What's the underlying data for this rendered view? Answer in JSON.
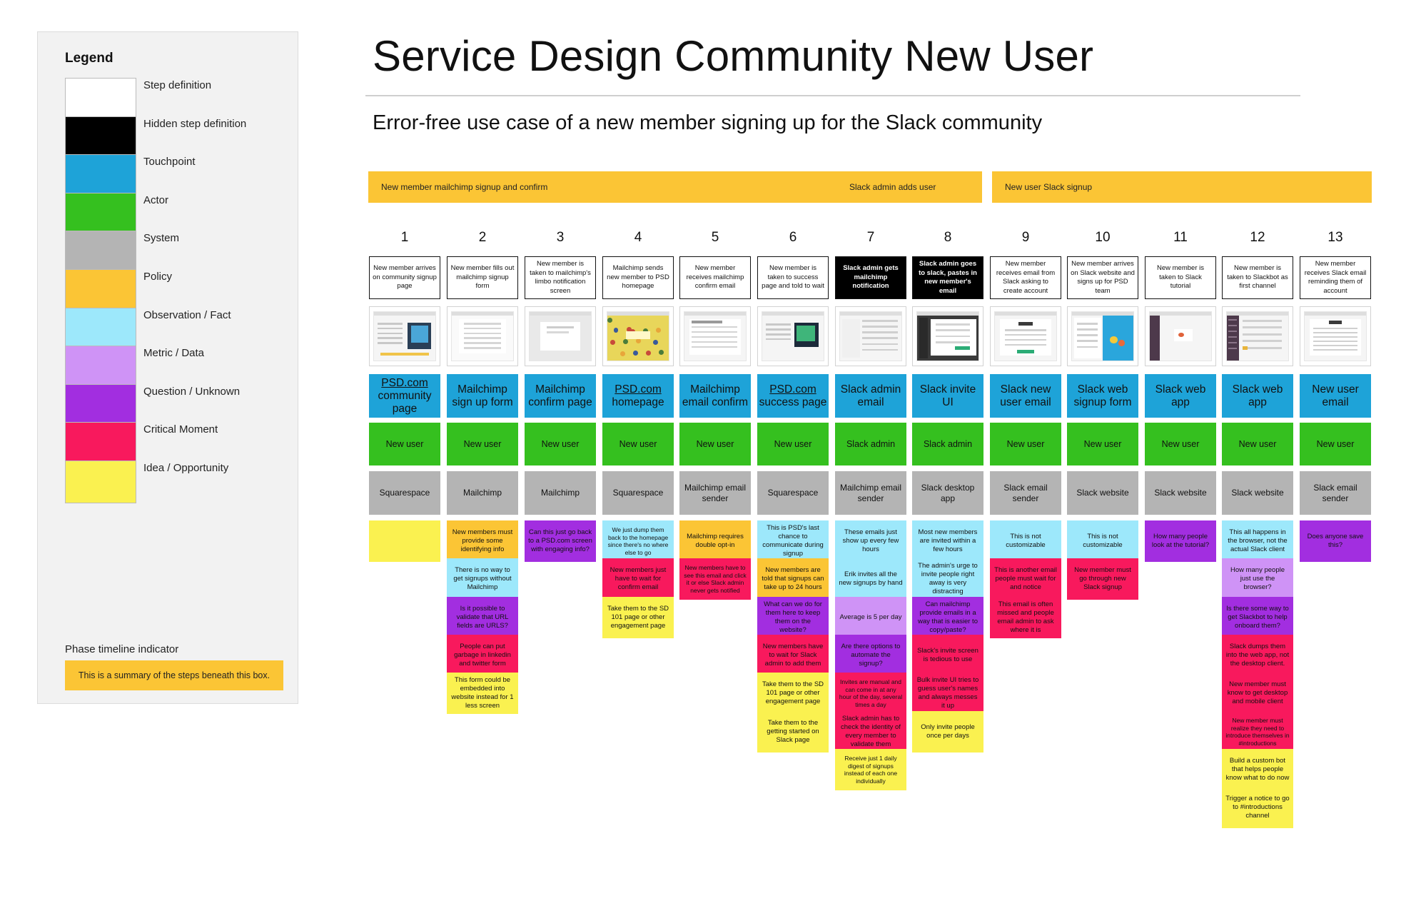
{
  "title": "Service Design Community New User",
  "subtitle": "Error-free use case of a new member signing up for the Slack community",
  "legend": {
    "title": "Legend",
    "items": [
      {
        "label": "Step definition",
        "color": "#ffffff"
      },
      {
        "label": "Hidden step definition",
        "color": "#000000"
      },
      {
        "label": "Touchpoint",
        "color": "#1ea3d8"
      },
      {
        "label": "Actor",
        "color": "#35c01f"
      },
      {
        "label": "System",
        "color": "#b4b4b4"
      },
      {
        "label": "Policy",
        "color": "#fbc535"
      },
      {
        "label": "Observation / Fact",
        "color": "#9de8fb"
      },
      {
        "label": "Metric / Data",
        "color": "#cf93f6"
      },
      {
        "label": "Question / Unknown",
        "color": "#a22ee0"
      },
      {
        "label": "Critical Moment",
        "color": "#f8195d"
      },
      {
        "label": "Idea / Opportunity",
        "color": "#faf150"
      }
    ],
    "phase_label": "Phase timeline indicator",
    "phase_example": "This is a summary of the steps beneath this box."
  },
  "phases": [
    {
      "label": "New member mailchimp signup and confirm"
    },
    {
      "label": "Slack admin adds user"
    },
    {
      "label": "New user Slack signup"
    }
  ],
  "steps": [
    {
      "num": "1",
      "definition": "New member arrives on community signup page",
      "hidden": false,
      "screenshot": "psd-community-page",
      "touchpoint": "PSD.com community page",
      "touchpoint_link": true,
      "actor": "New user",
      "system": "Squarespace",
      "notes": [
        {
          "text": "",
          "type": "idea"
        }
      ]
    },
    {
      "num": "2",
      "definition": "New member fills out mailchimp signup form",
      "hidden": false,
      "screenshot": "mailchimp-form",
      "touchpoint": "Mailchimp sign up form",
      "touchpoint_link": false,
      "actor": "New user",
      "system": "Mailchimp",
      "notes": [
        {
          "text": "New members must provide some identifying info",
          "type": "policy"
        },
        {
          "text": "There is no way to get signups without Mailchimp",
          "type": "obs"
        },
        {
          "text": "Is it possible to validate that URL fields are URLS?",
          "type": "question"
        },
        {
          "text": "People can put garbage in linkedin and twitter form",
          "type": "critical"
        },
        {
          "text": "This form could be embedded into website instead for 1 less screen",
          "type": "idea"
        }
      ]
    },
    {
      "num": "3",
      "definition": "New member is taken to mailchimp's limbo notification screen",
      "hidden": false,
      "screenshot": "mailchimp-confirm",
      "touchpoint": "Mailchimp confirm page",
      "touchpoint_link": false,
      "actor": "New user",
      "system": "Mailchimp",
      "notes": [
        {
          "text": "Can this just go back to a PSD.com screen with engaging info?",
          "type": "question"
        }
      ]
    },
    {
      "num": "4",
      "definition": "Mailchimp sends new member to PSD homepage",
      "hidden": false,
      "screenshot": "psd-homepage",
      "touchpoint": "PSD.com homepage",
      "touchpoint_link": true,
      "actor": "New user",
      "system": "Squarespace",
      "notes": [
        {
          "text": "We just dump them back to the homepage since there's no where else to go",
          "type": "obs"
        },
        {
          "text": "New members just have to wait for confirm email",
          "type": "critical"
        },
        {
          "text": "Take them to the SD 101 page or other engagement page",
          "type": "idea"
        }
      ]
    },
    {
      "num": "5",
      "definition": "New member receives mailchimp confirm email",
      "hidden": false,
      "screenshot": "mailchimp-email",
      "touchpoint": "Mailchimp email confirm",
      "touchpoint_link": false,
      "actor": "New user",
      "system": "Mailchimp email sender",
      "notes": [
        {
          "text": "Mailchimp requires double opt-in",
          "type": "policy"
        },
        {
          "text": "New members have to see this email and click it or else Slack admin never gets notified",
          "type": "critical"
        }
      ]
    },
    {
      "num": "6",
      "definition": "New member is taken to success page and told to wait",
      "hidden": false,
      "screenshot": "psd-success",
      "touchpoint": "PSD.com success page",
      "touchpoint_link": true,
      "actor": "New user",
      "system": "Squarespace",
      "notes": [
        {
          "text": "This is PSD's last chance to communicate during signup",
          "type": "obs"
        },
        {
          "text": "New members are told that signups can take up to 24 hours",
          "type": "policy"
        },
        {
          "text": "What can we do for them here to keep them on the website?",
          "type": "question"
        },
        {
          "text": "New members have to wait for Slack admin to add them",
          "type": "critical"
        },
        {
          "text": "Take them to the SD 101 page or other engagement page",
          "type": "idea"
        },
        {
          "text": "Take them to the getting started on Slack page",
          "type": "idea"
        }
      ]
    },
    {
      "num": "7",
      "definition": "Slack admin gets mailchimp notification",
      "hidden": true,
      "screenshot": "admin-email",
      "touchpoint": "Slack admin email",
      "touchpoint_link": false,
      "actor": "Slack admin",
      "system": "Mailchimp email sender",
      "notes": [
        {
          "text": "These emails just show up every few hours",
          "type": "obs"
        },
        {
          "text": "Erik invites all the new signups by hand",
          "type": "obs"
        },
        {
          "text": "Average is 5 per day",
          "type": "metric"
        },
        {
          "text": "Are there options to automate the signup?",
          "type": "question"
        },
        {
          "text": "Invites are manual and can come in at any hour of the day, several times a day",
          "type": "critical"
        },
        {
          "text": "Slack admin has to check the identity of every member to validate them",
          "type": "critical"
        },
        {
          "text": "Receive just 1 daily digest of signups instead of each one individually",
          "type": "idea"
        }
      ]
    },
    {
      "num": "8",
      "definition": "Slack admin goes to slack, pastes in new member's email",
      "hidden": true,
      "screenshot": "slack-invite",
      "touchpoint": "Slack invite UI",
      "touchpoint_link": false,
      "actor": "Slack admin",
      "system": "Slack desktop app",
      "notes": [
        {
          "text": "Most new members are invited within a few hours",
          "type": "obs"
        },
        {
          "text": "The admin's urge to invite people right away is very distracting",
          "type": "obs"
        },
        {
          "text": "Can mailchimp provide emails in a way that is easier to copy/paste?",
          "type": "question"
        },
        {
          "text": "Slack's invite screen is tedious to use",
          "type": "critical"
        },
        {
          "text": "Bulk invite UI tries to guess user's names and always messes it up",
          "type": "critical"
        },
        {
          "text": "Only invite people once per days",
          "type": "idea"
        }
      ]
    },
    {
      "num": "9",
      "definition": "New member receives email from Slack asking to create account",
      "hidden": false,
      "screenshot": "slack-email",
      "touchpoint": "Slack new user email",
      "touchpoint_link": false,
      "actor": "New user",
      "system": "Slack email sender",
      "notes": [
        {
          "text": "This is not customizable",
          "type": "obs"
        },
        {
          "text": "This is another email people must wait for and notice",
          "type": "critical"
        },
        {
          "text": "This email is often missed and people email admin to ask where it is",
          "type": "critical"
        }
      ]
    },
    {
      "num": "10",
      "definition": "New member arrives on Slack website and signs up for PSD team",
      "hidden": false,
      "screenshot": "slack-web-signup",
      "touchpoint": "Slack web signup form",
      "touchpoint_link": false,
      "actor": "New user",
      "system": "Slack website",
      "notes": [
        {
          "text": "This is not customizable",
          "type": "obs"
        },
        {
          "text": "New member must go through new Slack signup",
          "type": "critical"
        }
      ]
    },
    {
      "num": "11",
      "definition": "New member is taken to Slack tutorial",
      "hidden": false,
      "screenshot": "slack-tutorial",
      "touchpoint": "Slack web app",
      "touchpoint_link": false,
      "actor": "New user",
      "system": "Slack website",
      "notes": [
        {
          "text": "How many people look at the tutorial?",
          "type": "question"
        }
      ]
    },
    {
      "num": "12",
      "definition": "New member is taken to Slackbot as first channel",
      "hidden": false,
      "screenshot": "slackbot",
      "touchpoint": "Slack web app",
      "touchpoint_link": false,
      "actor": "New user",
      "system": "Slack website",
      "notes": [
        {
          "text": "This all happens in the browser, not the actual Slack client",
          "type": "obs"
        },
        {
          "text": "How many people just use the browser?",
          "type": "metric"
        },
        {
          "text": "Is there some way to get Slackbot to help onboard them?",
          "type": "question"
        },
        {
          "text": "Slack dumps them into the web app, not the desktop client.",
          "type": "critical"
        },
        {
          "text": "New member must know to get desktop and mobile client",
          "type": "critical"
        },
        {
          "text": "New member must realize they need to introduce themselves in #introductions",
          "type": "critical"
        },
        {
          "text": "Build a custom bot that helps people know what to do now",
          "type": "idea"
        },
        {
          "text": "Trigger a notice to go to #introductions channel",
          "type": "idea"
        }
      ]
    },
    {
      "num": "13",
      "definition": "New member receives Slack email reminding them of account",
      "hidden": false,
      "screenshot": "reminder-email",
      "touchpoint": "New user email",
      "touchpoint_link": false,
      "actor": "New user",
      "system": "Slack email sender",
      "notes": [
        {
          "text": "Does anyone save this?",
          "type": "question"
        }
      ]
    }
  ]
}
